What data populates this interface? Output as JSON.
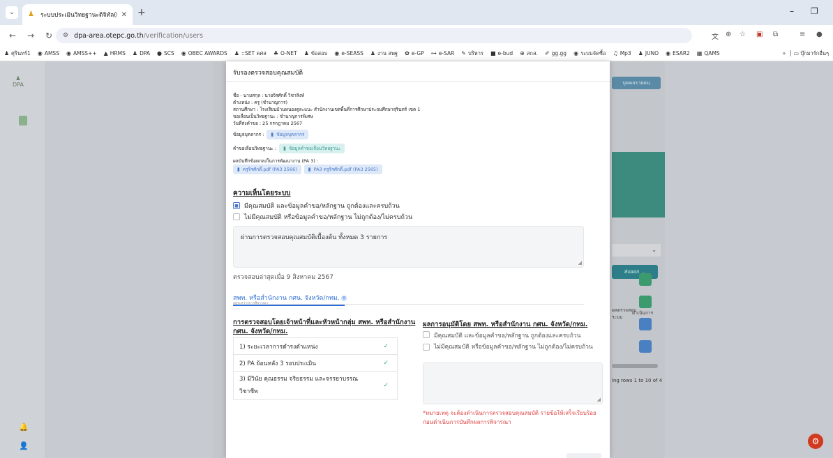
{
  "browser": {
    "tab_title": "ระบบประเมินวิทยฐานะดิจิทัล(DPA)",
    "url_host": "dpa-area.otepc.go.th",
    "url_path": "/verification/users",
    "bookmarks": [
      "ศุรินทร์1",
      "AMSS",
      "AMSS++",
      "HRMS",
      "DPA",
      "SCS",
      "OBEC AWARDS",
      "::SET คศส",
      "O-NET",
      "ข้อสอบ",
      "e-SEASS",
      "งาน สพฐ",
      "e-GP",
      "e-SAR",
      "บริหาร",
      "e-bud",
      "สกส.",
      "gg.gg",
      "ระบบจัดซื้อ",
      "Mp3",
      "JUNO",
      "ESAR2",
      "QAMS"
    ],
    "bookmarks_folder": "บุ๊กมาร์กอื่นๆ"
  },
  "background": {
    "top_button": "บุคคลรายคน",
    "export_button": "ส่งออก",
    "col_header_1": "ผลตรวจสอบ\nระบบ",
    "col_header_2": "ดำเนินการ",
    "paging_text": "ing rows 1 to 10 of 4"
  },
  "modal": {
    "title": "รับรองตรวจสอบคุณสมบัติ",
    "info": {
      "name": "ชื่อ - นามสกุล : นายจิรศักดิ์ วิชาสิงห์",
      "position": "ตำแหน่ง : ครู (ชำนาญการ)",
      "school": "สถานศึกษา : โรงเรียนบ้านหนองดูละแบะ สำนักงานเขตพื้นที่การศึกษาประถมศึกษาสุรินทร์ เขต 1",
      "request": "ขอเลื่อนเป็นวิทยฐานะ : ชำนาญการพิเศษ",
      "date": "วันที่ส่งคำขอ : 25 กรกฎาคม 2567",
      "personnel_label": "ข้อมูลบุคลากร :",
      "personnel_chip": "ข้อมูลบุคลากร",
      "request_label": "คำขอเลื่อนวิทยฐานะ :",
      "request_chip": "ข้อมูลคำขอเลื่อนวิทยฐานะ",
      "pa_label": "ผลบันทึกข้อตกลงในการพัฒนางาน (PA 3) :",
      "pa_file_1": "ครูจิรศักดิ์.pdf (PA3 2566)",
      "pa_file_2": "PA3 ครูจิรศักดิ์.pdf (PA3 2565)"
    },
    "system_opinion": {
      "heading": "ความเห็นโดยระบบ",
      "option_yes": "มีคุณสมบัติ และข้อมูลคำขอ/หลักฐาน ถูกต้องและครบถ้วน",
      "option_no": "ไม่มีคุณสมบัติ หรือข้อมูลคำขอ/หลักฐาน ไม่ถูกต้อง/ไม่ครบถ้วน",
      "comment": "ผ่านการตรวจสอบคุณสมบัติเบื้องต้น ทั้งหมด 3 รายการ",
      "checked_at": "ตรวจสอบล่าสุดเมื่อ 9 สิงหาคม 2567"
    },
    "tab": {
      "label": "สพท. หรือสำนักงาน กศน. จังหวัด/กทม.",
      "count": "0",
      "sub": "อยู่ระหว่างการพิจารณา"
    },
    "officer_check": {
      "heading": "การตรวจสอบโดยเจ้าหน้าที่และหัวหน้ากลุ่ม สพท. หรือสำนักงาน กศน. จังหวัด/กทม.",
      "items": [
        {
          "label": "1) ระยะเวลาการดำรงตำแหน่ง"
        },
        {
          "label": "2) PA ย้อนหลัง 3 รอบประเมิน"
        },
        {
          "label": "3) มีวินัย คุณธรรม จริยธรรม และจรรยาบรรณวิชาชีพ"
        }
      ]
    },
    "approval": {
      "heading": "ผลการอนุมัติโดย สพท. หรือสำนักงาน กศน. จังหวัด/กทม.",
      "option_yes": "มีคุณสมบัติ และข้อมูลคำขอ/หลักฐาน ถูกต้องและครบถ้วน",
      "option_no": "ไม่มีคุณสมบัติ หรือข้อมูลคำขอ/หลักฐาน ไม่ถูกต้อง/ไม่ครบถ้วน",
      "note": "*หมายเหตุ จะต้องดำเนินการตรวจสอบคุณสมบัติ รายข้อให้เสร็จเรียบร้อยก่อนดำเนินการบันทึกผลการพิจารณา"
    }
  }
}
